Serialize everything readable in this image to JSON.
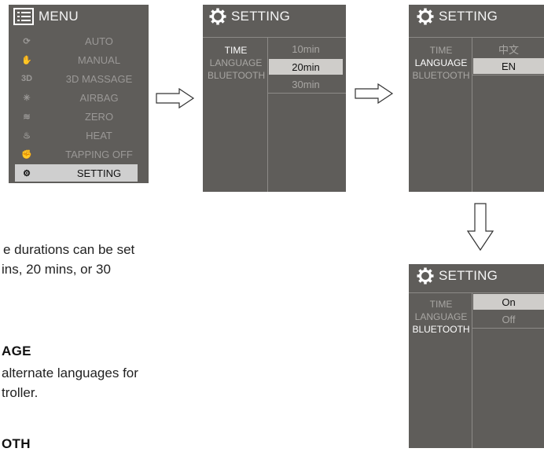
{
  "menu_panel": {
    "title": "MENU",
    "items": [
      {
        "icon": "auto-icon",
        "label": "AUTO"
      },
      {
        "icon": "manual-icon",
        "label": "MANUAL"
      },
      {
        "icon_text": "3D",
        "label": "3D MASSAGE"
      },
      {
        "icon": "airbag-icon",
        "label": "AIRBAG"
      },
      {
        "icon": "zero-gravity-icon",
        "label": "ZERO"
      },
      {
        "icon": "heat-icon",
        "label": "HEAT"
      },
      {
        "icon": "tapping-icon",
        "label": "TAPPING OFF"
      },
      {
        "icon": "gear-icon",
        "label": "SETTING",
        "active": true
      }
    ]
  },
  "setting_time": {
    "title": "SETTING",
    "labels": [
      "TIME",
      "LANGUAGE",
      "BLUETOOTH"
    ],
    "options": [
      "10min",
      "20min",
      "30min"
    ],
    "selected_option": "20min"
  },
  "setting_language": {
    "title": "SETTING",
    "labels": [
      "TIME",
      "LANGUAGE",
      "BLUETOOTH"
    ],
    "options": [
      "中文",
      "EN"
    ],
    "selected_option": "EN"
  },
  "setting_bluetooth": {
    "title": "SETTING",
    "labels": [
      "TIME",
      "LANGUAGE",
      "BLUETOOTH"
    ],
    "options": [
      "On",
      "Off"
    ],
    "selected_option": "On"
  },
  "body_text": {
    "line1": "e durations can be set",
    "line2": "ins, 20 mins, or 30",
    "heading_language": "AGE",
    "lang_line1": "alternate languages for",
    "lang_line2": "troller.",
    "heading_bluetooth": "OTH"
  },
  "colors": {
    "panel_bg": "#5f5d5a",
    "selected_bg": "#cfcdca"
  }
}
